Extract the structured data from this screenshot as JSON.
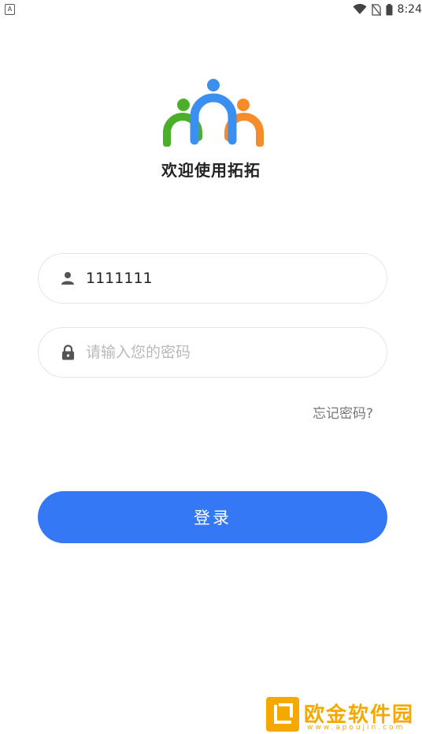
{
  "status_bar": {
    "left_icon_text": "A",
    "time": "8:24",
    "icons": [
      "wifi-icon",
      "no-sim-icon",
      "battery-icon"
    ]
  },
  "brand": {
    "welcome_text": "欢迎使用拓拓",
    "logo_colors": {
      "left": "#4caf2a",
      "center": "#3b8ff0",
      "right": "#f58c2a"
    }
  },
  "login_form": {
    "username_value": "1111111",
    "username_icon": "person-icon",
    "password_placeholder": "请输入您的密码",
    "password_icon": "lock-icon",
    "forgot_label": "忘记密码?",
    "login_label": "登录",
    "accent_color": "#3478f6"
  },
  "watermark": {
    "title": "欧金软件园",
    "subtitle": "www.apoujin.com",
    "color": "#f5a800"
  }
}
